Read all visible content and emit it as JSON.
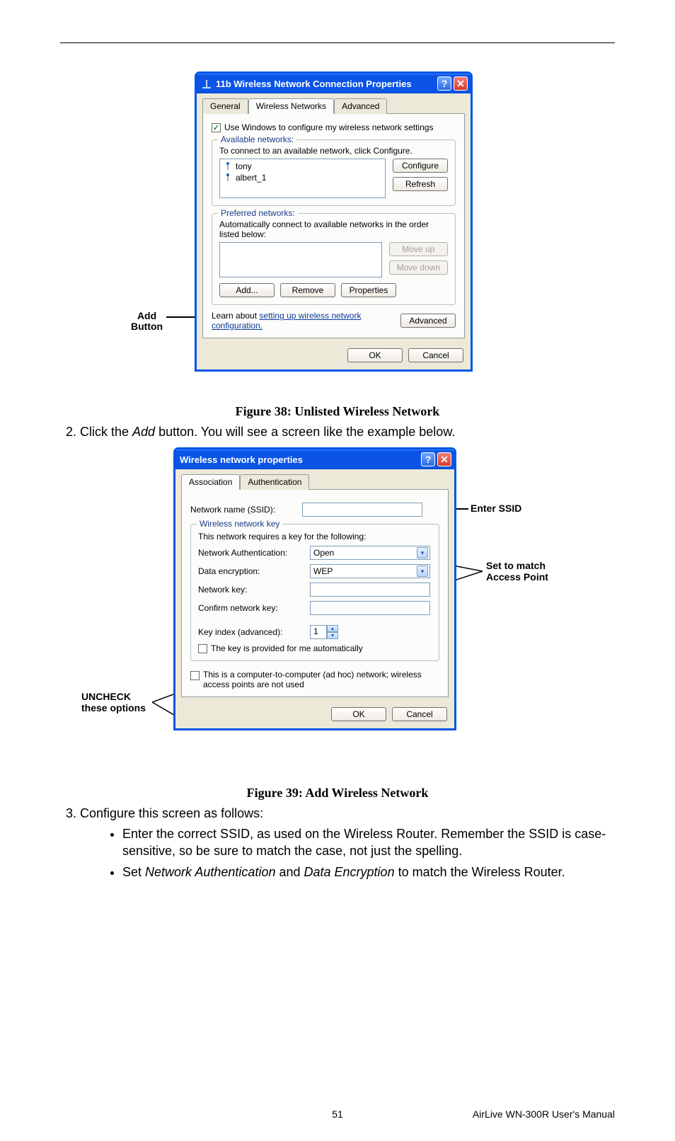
{
  "figure38": {
    "title": "11b Wireless Network Connection Properties",
    "tabs": {
      "general": "General",
      "wireless": "Wireless Networks",
      "advanced": "Advanced"
    },
    "useWindows": "Use Windows to configure my wireless network settings",
    "availableLegend": "Available networks:",
    "availableHelp": "To connect to an available network, click Configure.",
    "networks": [
      "tony",
      "albert_1"
    ],
    "configureBtn": "Configure",
    "refreshBtn": "Refresh",
    "preferredLegend": "Preferred networks:",
    "preferredHelp": "Automatically connect to available networks in the order listed below:",
    "moveUpBtn": "Move up",
    "moveDownBtn": "Move down",
    "addBtn": "Add...",
    "removeBtn": "Remove",
    "propertiesBtn": "Properties",
    "learnText1": "Learn about ",
    "learnLink": "setting up wireless network configuration.",
    "advancedBtn": "Advanced",
    "okBtn": "OK",
    "cancelBtn": "Cancel",
    "caption": "Figure 38: Unlisted Wireless Network",
    "annAddButton1": "Add",
    "annAddButton2": "Button"
  },
  "step2": {
    "prefix": "Click the ",
    "addWord": "Add",
    "suffix": " button. You will see a screen like the example below."
  },
  "figure39": {
    "title": "Wireless network properties",
    "tabs": {
      "association": "Association",
      "authentication": "Authentication"
    },
    "ssidLabel": "Network name (SSID):",
    "ssidValue": "",
    "wkeyLegend": "Wireless network key",
    "wkeyHelp": "This network requires a key for the following:",
    "netAuthLabel": "Network Authentication:",
    "netAuthValue": "Open",
    "dataEncLabel": "Data encryption:",
    "dataEncValue": "WEP",
    "netKeyLabel": "Network key:",
    "confirmKeyLabel": "Confirm network key:",
    "keyIndexLabel": "Key index (advanced):",
    "keyIndexValue": "1",
    "autoKeyLabel": "The key is provided for me automatically",
    "adhocLabel": "This is a computer-to-computer (ad hoc) network; wireless access points are not used",
    "okBtn": "OK",
    "cancelBtn": "Cancel",
    "caption": "Figure 39: Add Wireless Network",
    "annEnterSSID": "Enter SSID",
    "annSetMatch1": "Set to match",
    "annSetMatch2": "Access Point",
    "annUncheck1": "UNCHECK",
    "annUncheck2": "these options"
  },
  "step3": {
    "intro": "Configure this screen as follows:",
    "b1a": "Enter the correct SSID, as used on the Wireless Router. Remember the SSID is case-sensitive, so be sure to match the case, not just the spelling.",
    "b2a": "Set ",
    "b2b": "Network Authentication",
    "b2c": " and ",
    "b2d": "Data Encryption",
    "b2e": " to match the Wireless Router."
  },
  "footer": {
    "page": "51",
    "manual": "AirLive WN-300R User's Manual"
  }
}
